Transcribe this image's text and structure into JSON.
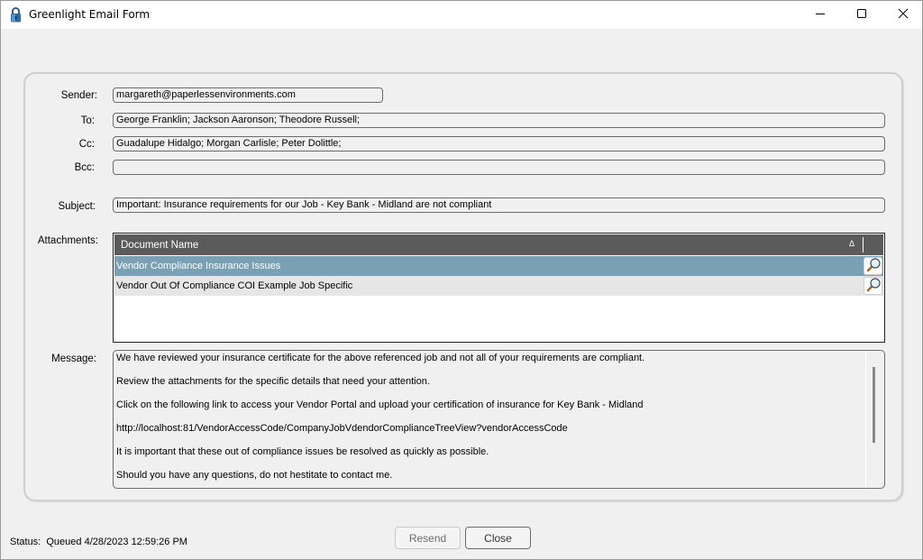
{
  "window": {
    "title": "Greenlight Email Form",
    "app_icon": "padlock-icon",
    "controls": {
      "minimize": "minimize-icon",
      "maximize": "maximize-icon",
      "close": "close-icon"
    }
  },
  "form": {
    "sender": {
      "label": "Sender:",
      "value": "margareth@paperlessenvironments.com"
    },
    "to": {
      "label": "To:",
      "value": "George Franklin; Jackson Aaronson; Theodore Russell;"
    },
    "cc": {
      "label": "Cc:",
      "value": "Guadalupe Hidalgo; Morgan Carlisle; Peter Dolittle;"
    },
    "bcc": {
      "label": "Bcc:",
      "value": ""
    },
    "subject": {
      "label": "Subject:",
      "value": "Important: Insurance requirements for our Job - Key Bank - Midland are not compliant"
    },
    "attachments": {
      "label": "Attachments:",
      "column_header": "Document Name",
      "sort_indicator": "Δ",
      "rows": [
        {
          "name": "Vendor Compliance Insurance Issues",
          "selected": true,
          "action_icon": "magnifier-icon"
        },
        {
          "name": "Vendor Out Of Compliance COI Example Job Specific",
          "selected": false,
          "action_icon": "magnifier-icon"
        }
      ]
    },
    "message": {
      "label": "Message:",
      "lines": [
        "We have reviewed your insurance certificate for the above referenced job and not all of your requirements are compliant.",
        "Review the attachments for the specific details that need your attention.",
        "Click on the following link to access your Vendor Portal and upload your certification of insurance for Key Bank - Midland",
        "http://localhost:81/VendorAccessCode/CompanyJobVdendorComplianceTreeView?vendorAccessCode",
        "It is important that these out of compliance issues be resolved as quickly as possible.",
        "Should you have any questions, do not hestitate to contact me."
      ]
    }
  },
  "footer": {
    "status_label": "Status:",
    "status_value": "Queued 4/28/2023 12:59:26 PM",
    "resend_label": "Resend",
    "close_label": "Close"
  },
  "colors": {
    "selected_row": "#7aa0b4",
    "header_bg": "#5b5b5b",
    "window_bg": "#f0f0f0"
  }
}
